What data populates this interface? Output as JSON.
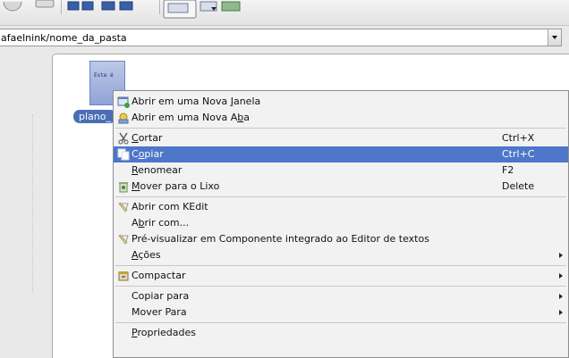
{
  "toolbar": {
    "buttons": [
      "back-icon",
      "forward-icon",
      "view-mode-icon",
      "sort-icon",
      "zoom-icon"
    ]
  },
  "location": {
    "path": "afaelnink/nome_da_pasta"
  },
  "file": {
    "thumb_text": "Este é",
    "name": "plano_"
  },
  "menu": {
    "items": [
      {
        "label": "Abrir em uma Nova Janela",
        "icon": "new-window-icon"
      },
      {
        "label": "Abrir em uma Nova Aba",
        "icon": "new-tab-icon"
      },
      {
        "label": "Cortar",
        "shortcut": "Ctrl+X",
        "icon": "scissors-icon"
      },
      {
        "label": "Copiar",
        "shortcut": "Ctrl+C",
        "icon": "copy-icon",
        "highlighted": true
      },
      {
        "label": "Renomear",
        "shortcut": "F2"
      },
      {
        "label": "Mover para o Lixo",
        "shortcut": "Delete",
        "icon": "trash-icon"
      },
      {
        "label": "Abrir com KEdit",
        "icon": "edit-icon"
      },
      {
        "label": "Abrir com..."
      },
      {
        "label": "Pré-visualizar em Componente integrado ao Editor de textos",
        "icon": "preview-icon"
      },
      {
        "label": "Ações",
        "submenu": true
      },
      {
        "label": "Compactar",
        "submenu": true,
        "icon": "archive-icon"
      },
      {
        "label": "Copiar para",
        "submenu": true
      },
      {
        "label": "Mover Para",
        "submenu": true
      },
      {
        "label": "Propriedades"
      }
    ]
  },
  "colors": {
    "highlight": "#4e76c9",
    "selection_label": "#4a6fb7"
  }
}
